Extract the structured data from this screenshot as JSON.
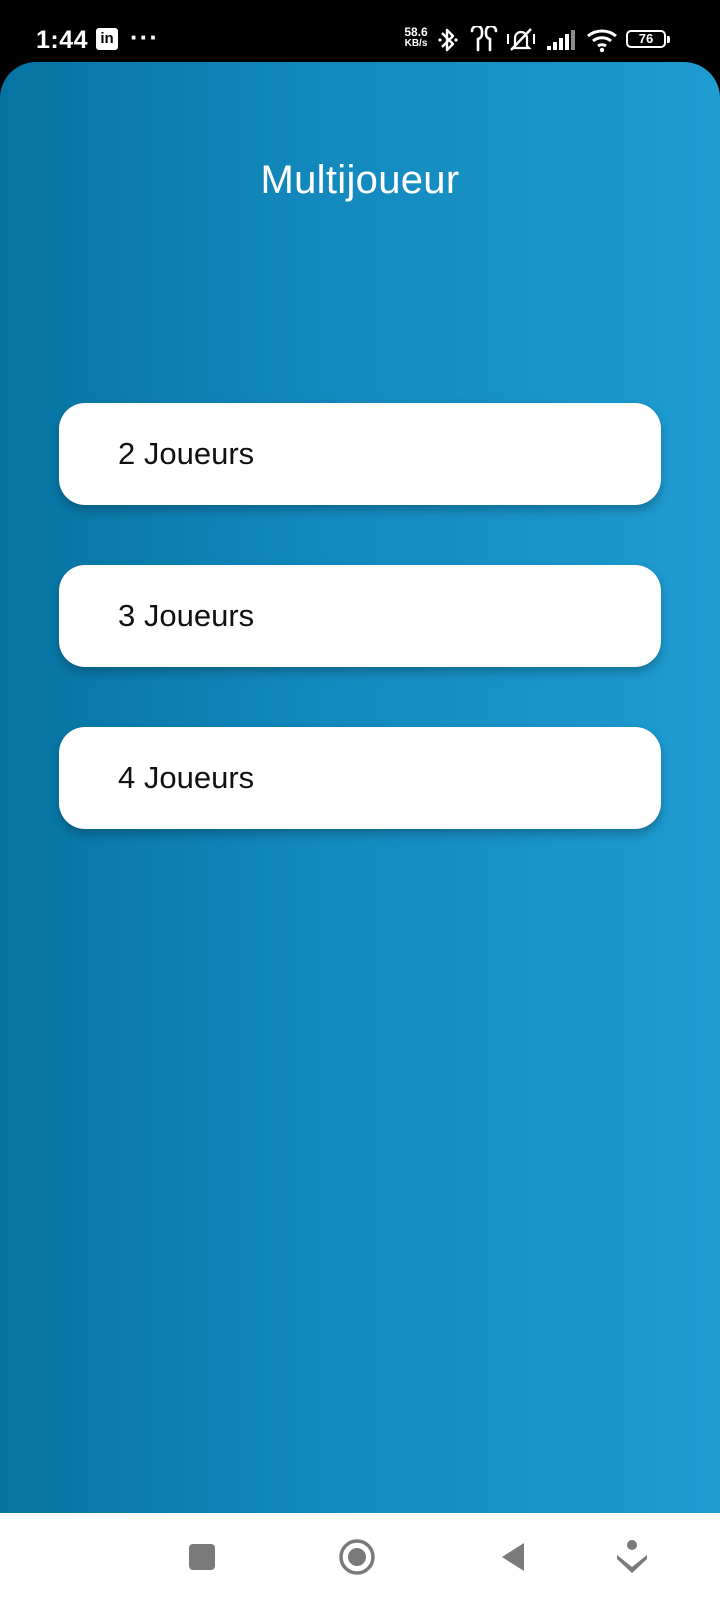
{
  "status_bar": {
    "time": "1:44",
    "notification_app": "in",
    "more_notifications": "···",
    "net_speed_value": "58.6",
    "net_speed_unit": "KB/s",
    "battery": "76",
    "icons": [
      "linkedin-icon",
      "bluetooth-icon",
      "earbuds-icon",
      "vibrate-off-icon",
      "signal-icon",
      "wifi-icon",
      "battery-icon"
    ]
  },
  "screen": {
    "title": "Multijoueur",
    "gradient_colors": [
      "#0674a2",
      "#1f9cd1"
    ],
    "options": [
      {
        "label": "2 Joueurs"
      },
      {
        "label": "3 Joueurs"
      },
      {
        "label": "4 Joueurs"
      }
    ]
  },
  "nav_bar": {
    "buttons": [
      "recents-icon",
      "home-icon",
      "back-icon",
      "assistant-icon"
    ]
  }
}
